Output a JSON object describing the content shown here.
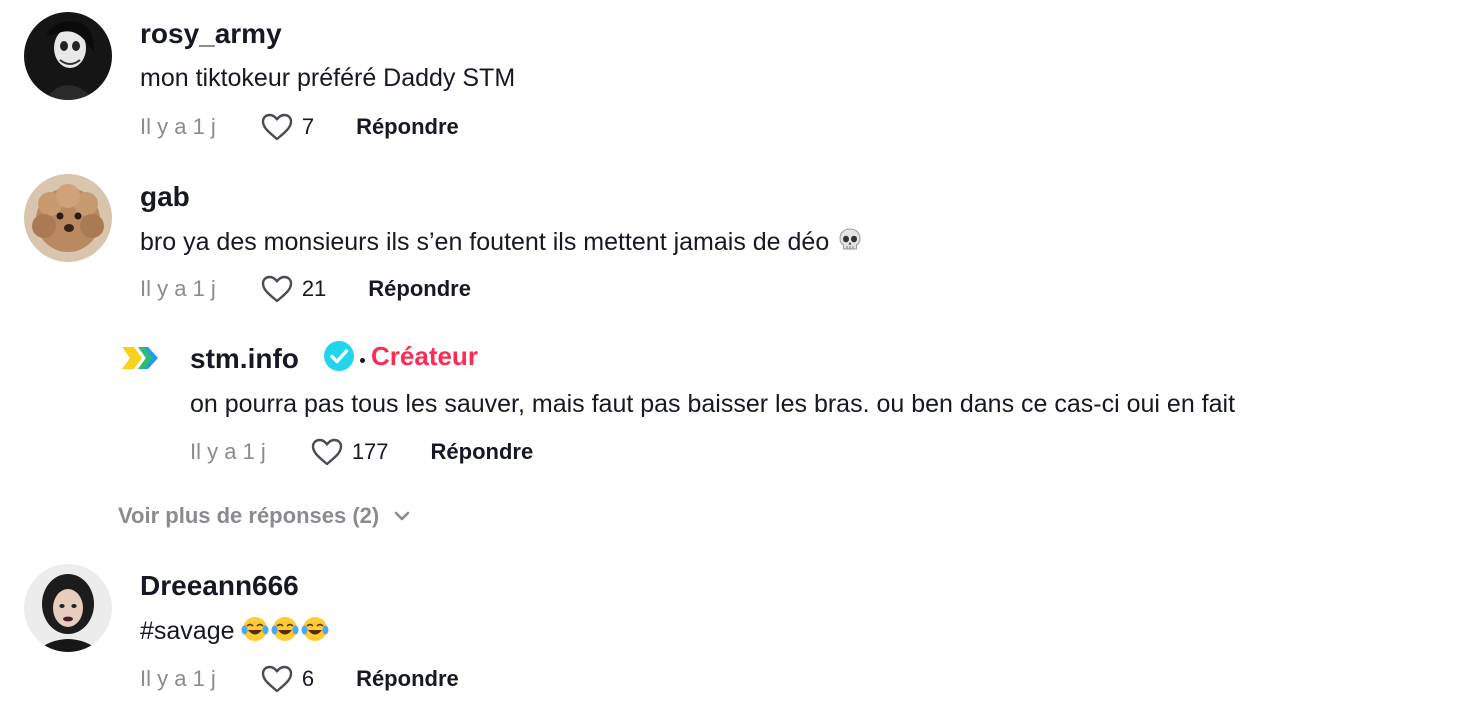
{
  "comments": [
    {
      "username": "rosy_army",
      "text": "mon tiktokeur préféré Daddy STM",
      "time": "Il y a 1 j",
      "likes": "7",
      "reply_label": "Répondre"
    },
    {
      "username": "gab",
      "text": "bro ya des monsieurs ils s’en foutent ils mettent jamais de déo",
      "time": "Il y a 1 j",
      "likes": "21",
      "reply_label": "Répondre",
      "reply": {
        "username": "stm.info",
        "badge": "Créateur",
        "text": "on pourra pas tous les sauver, mais faut pas baisser les bras. ou ben dans ce cas-ci oui en fait",
        "time": "Il y a 1 j",
        "likes": "177",
        "reply_label": "Répondre"
      },
      "more_replies": "Voir plus de réponses (2)"
    },
    {
      "username": "Dreeann666",
      "text": "#savage",
      "time": "Il y a 1 j",
      "likes": "6",
      "reply_label": "Répondre"
    }
  ],
  "colors": {
    "creator_badge": "#fe2c55",
    "verified": "#20d5ec",
    "meta_gray": "#8a8b91",
    "text": "#161823"
  },
  "icons": {
    "like": "heart-outline-icon",
    "verified": "verified-check-icon",
    "expand": "chevron-down-icon",
    "skull": "skull-emoji",
    "laugh": "face-with-tears-of-joy-emoji"
  }
}
